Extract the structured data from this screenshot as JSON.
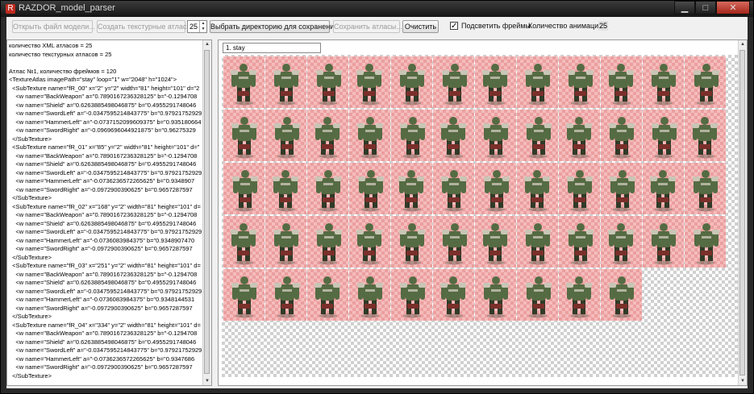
{
  "window": {
    "title": "RAZDOR_model_parser",
    "app_icon": "app-icon",
    "controls": {
      "minimize": "▁",
      "maximize": "□",
      "close": "✕"
    }
  },
  "toolbar": {
    "open_model": "Открыть файл модели...",
    "create_atlases": "Создать текстурные атласы",
    "atlas_count": "25",
    "choose_dir": "Выбрать директорию для сохранения...",
    "save_atlases": "Сохранить атласы...",
    "clear": "Очистить",
    "highlight_checked": "✓",
    "highlight_frames": "Подсветить фреймы",
    "anim_count_label": "Количество анимаций:",
    "anim_count": "25"
  },
  "log_text": "количество XML атласов = 25\nколичество текстурных атласов = 25\n\nАтлас №1, количество фреймов = 120\n<TextureAtlas imagePath=\"stay\" loop=\"1\" w=\"2048\" h=\"1024\">\n  <SubTexture name=\"fR_00\" x=\"2\" y=\"2\" width=\"81\" height=\"101\" d=\"2\n    <w name=\"BackWeapon\" a=\"0.7890167236328125\" b=\"-0.1294708\n    <w name=\"Shield\" a=\"0.6263885498046875\" b=\"0.4955291748046\n    <w name=\"SwordLeft\" a=\"-0.0347595214843775\" b=\"0.97921752929\n    <w name=\"HammerLeft\" a=\"-0.0737152099609375\" b=\"0.935180664\n    <w name=\"SwordRight\" a=\"-0.0969696044921875\" b=\"0.96275329\n  </SubTexture>\n  <SubTexture name=\"fR_01\" x=\"85\" y=\"2\" width=\"81\" height=\"101\" d=\"\n    <w name=\"BackWeapon\" a=\"0.7890167236328125\" b=\"-0.1294708\n    <w name=\"Shield\" a=\"0.6263885498046875\" b=\"0.4955291748046\n    <w name=\"SwordLeft\" a=\"-0.0347595214843775\" b=\"0.97921752929\n    <w name=\"HammerLeft\" a=\"-0.0736236572265625\" b=\"0.9348907\n    <w name=\"SwordRight\" a=\"-0.0972900390625\" b=\"0.9657287597\n  </SubTexture>\n  <SubTexture name=\"fR_02\" x=\"168\" y=\"2\" width=\"81\" height=\"101\" d=\n    <w name=\"BackWeapon\" a=\"0.7890167236328125\" b=\"-0.1294708\n    <w name=\"Shield\" a=\"0.6263885498046875\" b=\"0.4955291748046\n    <w name=\"SwordLeft\" a=\"-0.0347595214843775\" b=\"0.97921752929\n    <w name=\"HammerLeft\" a=\"-0.0736083984375\" b=\"0.9348907470\n    <w name=\"SwordRight\" a=\"-0.0972900390625\" b=\"0.9657287597\n  </SubTexture>\n  <SubTexture name=\"fR_03\" x=\"251\" y=\"2\" width=\"81\" height=\"101\" d=\n    <w name=\"BackWeapon\" a=\"0.7890167236328125\" b=\"-0.1294708\n    <w name=\"Shield\" a=\"0.6263885498046875\" b=\"0.4955291748046\n    <w name=\"SwordLeft\" a=\"-0.0347595214843775\" b=\"0.97921752929\n    <w name=\"HammerLeft\" a=\"-0.0736083984375\" b=\"0.9348144531\n    <w name=\"SwordRight\" a=\"-0.0972900390625\" b=\"0.9657287597\n  </SubTexture>\n  <SubTexture name=\"fR_04\" x=\"334\" y=\"2\" width=\"81\" height=\"101\" d=\n    <w name=\"BackWeapon\" a=\"0.7890167236328125\" b=\"-0.1294708\n    <w name=\"Shield\" a=\"0.6263885498046875\" b=\"0.4955291748046\n    <w name=\"SwordLeft\" a=\"-0.0347595214843775\" b=\"0.97921752929\n    <w name=\"HammerLeft\" a=\"-0.0736236572265625\" b=\"0.9347686\n    <w name=\"SwordRight\" a=\"-0.0972900390625\" b=\"0.9657287597\n  </SubTexture>",
  "animation_select": "1. stay",
  "atlas": {
    "row_frame_counts": [
      12,
      12,
      12,
      12,
      10
    ],
    "frame_highlight_color": "#f5bcbc",
    "sprite_icon": "orc-warrior-sprite"
  },
  "colors": {
    "sprite_body": "#556b43",
    "sprite_shadow": "#2f3a27",
    "sprite_metal": "#c9c6b6",
    "sprite_cloth": "#7a2f2a"
  }
}
